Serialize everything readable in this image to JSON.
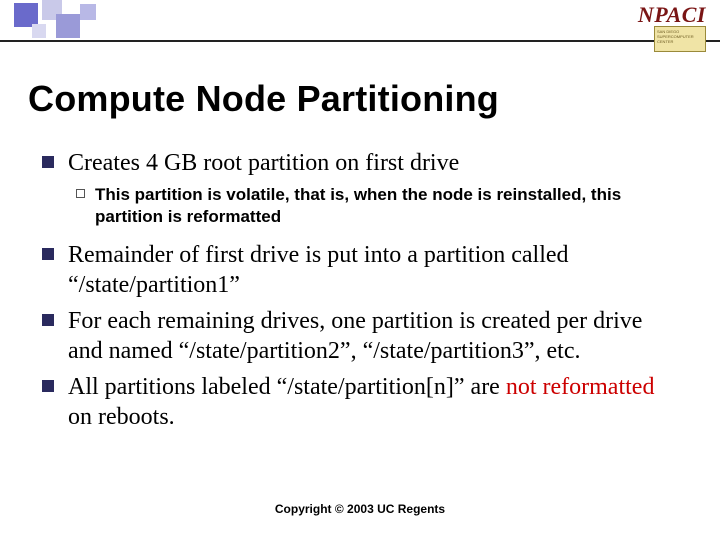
{
  "logos": {
    "npaci": "NPACI",
    "sdsc_lines": "SAN DIEGO SUPERCOMPUTER CENTER"
  },
  "title": "Compute Node Partitioning",
  "bullets": [
    {
      "text": "Creates 4 GB root partition on first drive",
      "sub": [
        "This partition is volatile, that is, when the node is reinstalled, this partition is reformatted"
      ]
    },
    {
      "text": "Remainder of first drive is put into a partition called “/state/partition1”"
    },
    {
      "text": "For each remaining drives, one partition is created per drive and named “/state/partition2”, “/state/partition3”, etc."
    },
    {
      "text_pre": "All partitions labeled “/state/partition[n]” are ",
      "text_red": "not reformatted",
      "text_post": " on reboots."
    }
  ],
  "footer": "Copyright © 2003 UC Regents"
}
